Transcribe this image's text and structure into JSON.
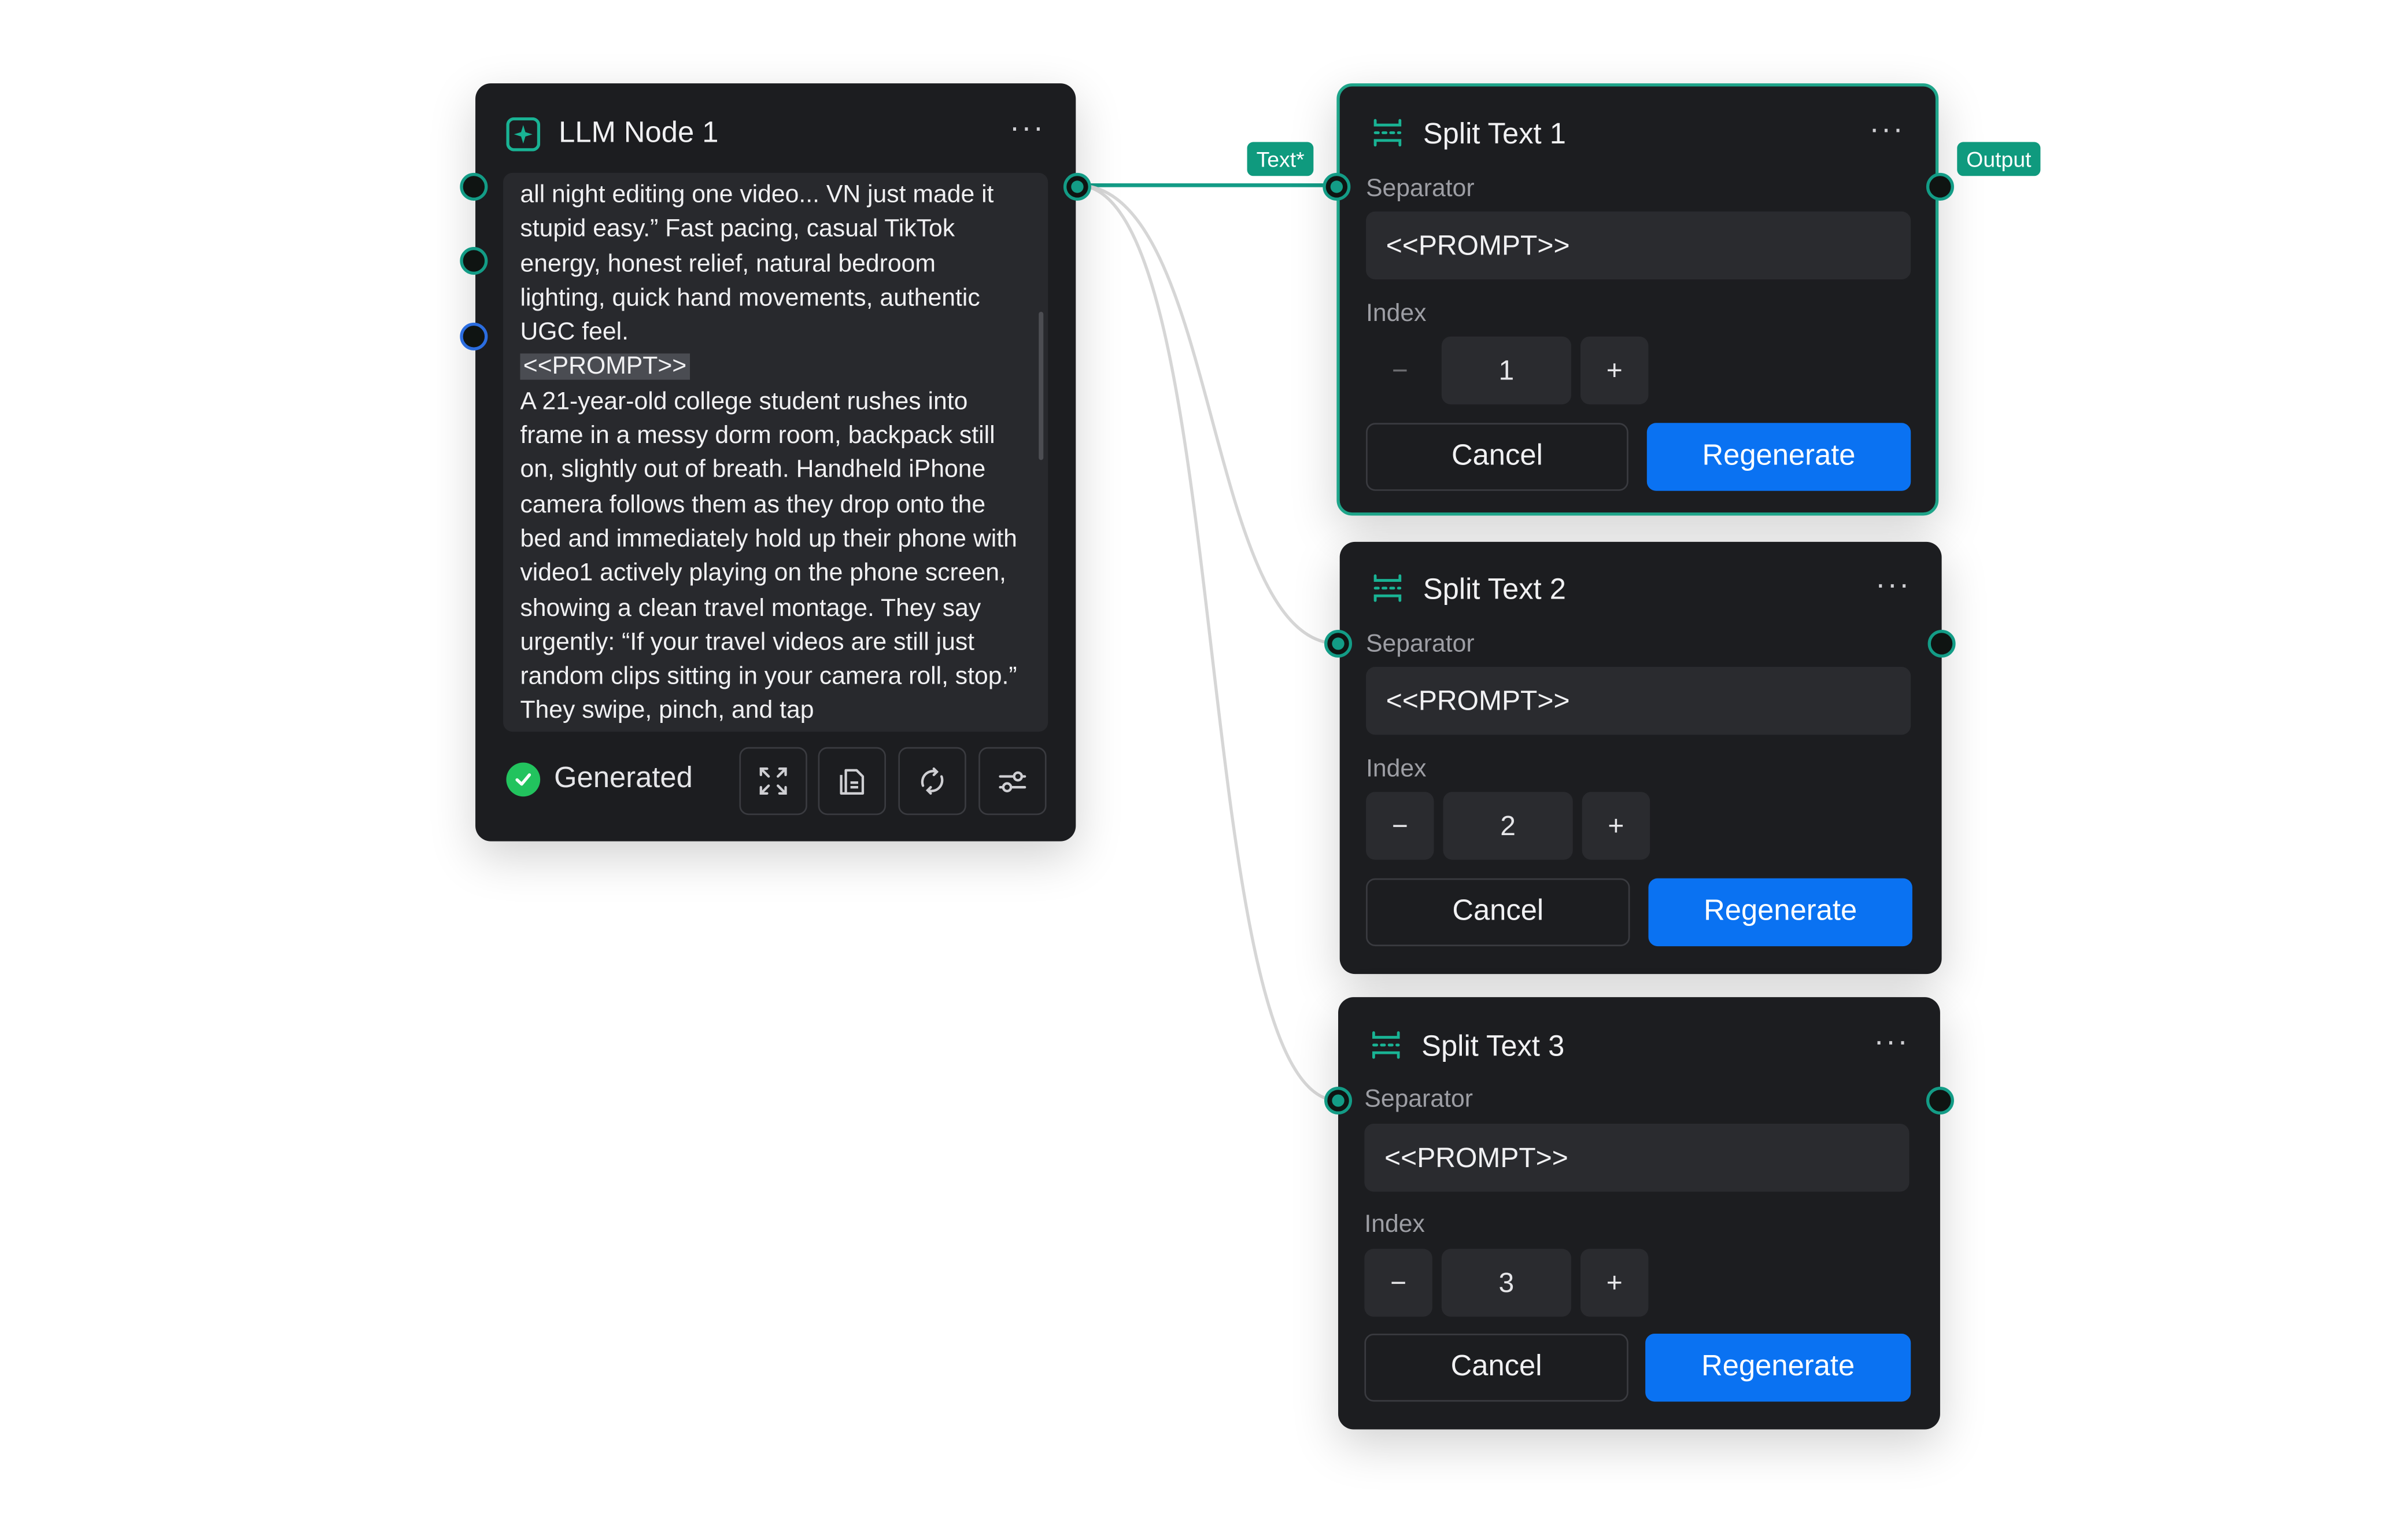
{
  "colors": {
    "accent": "#139c86",
    "primary_button": "#0a72f2",
    "node_bg": "#1c1d20",
    "success": "#22c35e"
  },
  "llm_node": {
    "title": "LLM Node 1",
    "icon": "sparkle-icon",
    "more_icon": "more-horizontal-icon",
    "text_before": "all night editing one video... VN just made it stupid easy.” Fast pacing, casual TikTok energy, honest relief, natural bedroom lighting, quick hand movements, authentic UGC feel.\n",
    "text_highlight": "<<PROMPT>>",
    "text_after": "\nA 21-year-old college student rushes into frame in a messy dorm room, backpack still on, slightly out of breath. Handheld iPhone camera follows them as they drop onto the bed and immediately hold up their phone with video1 actively playing on the phone screen, showing a clean travel montage. They say urgently: “If your travel videos are still just random clips sitting in your camera roll, stop.” They swipe, pinch, and tap",
    "status": "Generated",
    "tools": [
      "expand-icon",
      "copy-document-icon",
      "refresh-icon",
      "settings-sliders-icon"
    ]
  },
  "edge_tags": {
    "input": "Text*",
    "output": "Output"
  },
  "split_nodes": [
    {
      "title": "Split Text 1",
      "separator_label": "Separator",
      "separator_value": "<<PROMPT>>",
      "index_label": "Index",
      "index_value": "1",
      "minus": "−",
      "plus": "+",
      "cancel": "Cancel",
      "regenerate": "Regenerate"
    },
    {
      "title": "Split Text 2",
      "separator_label": "Separator",
      "separator_value": "<<PROMPT>>",
      "index_label": "Index",
      "index_value": "2",
      "minus": "−",
      "plus": "+",
      "cancel": "Cancel",
      "regenerate": "Regenerate"
    },
    {
      "title": "Split Text 3",
      "separator_label": "Separator",
      "separator_value": "<<PROMPT>>",
      "index_label": "Index",
      "index_value": "3",
      "minus": "−",
      "plus": "+",
      "cancel": "Cancel",
      "regenerate": "Regenerate"
    }
  ]
}
